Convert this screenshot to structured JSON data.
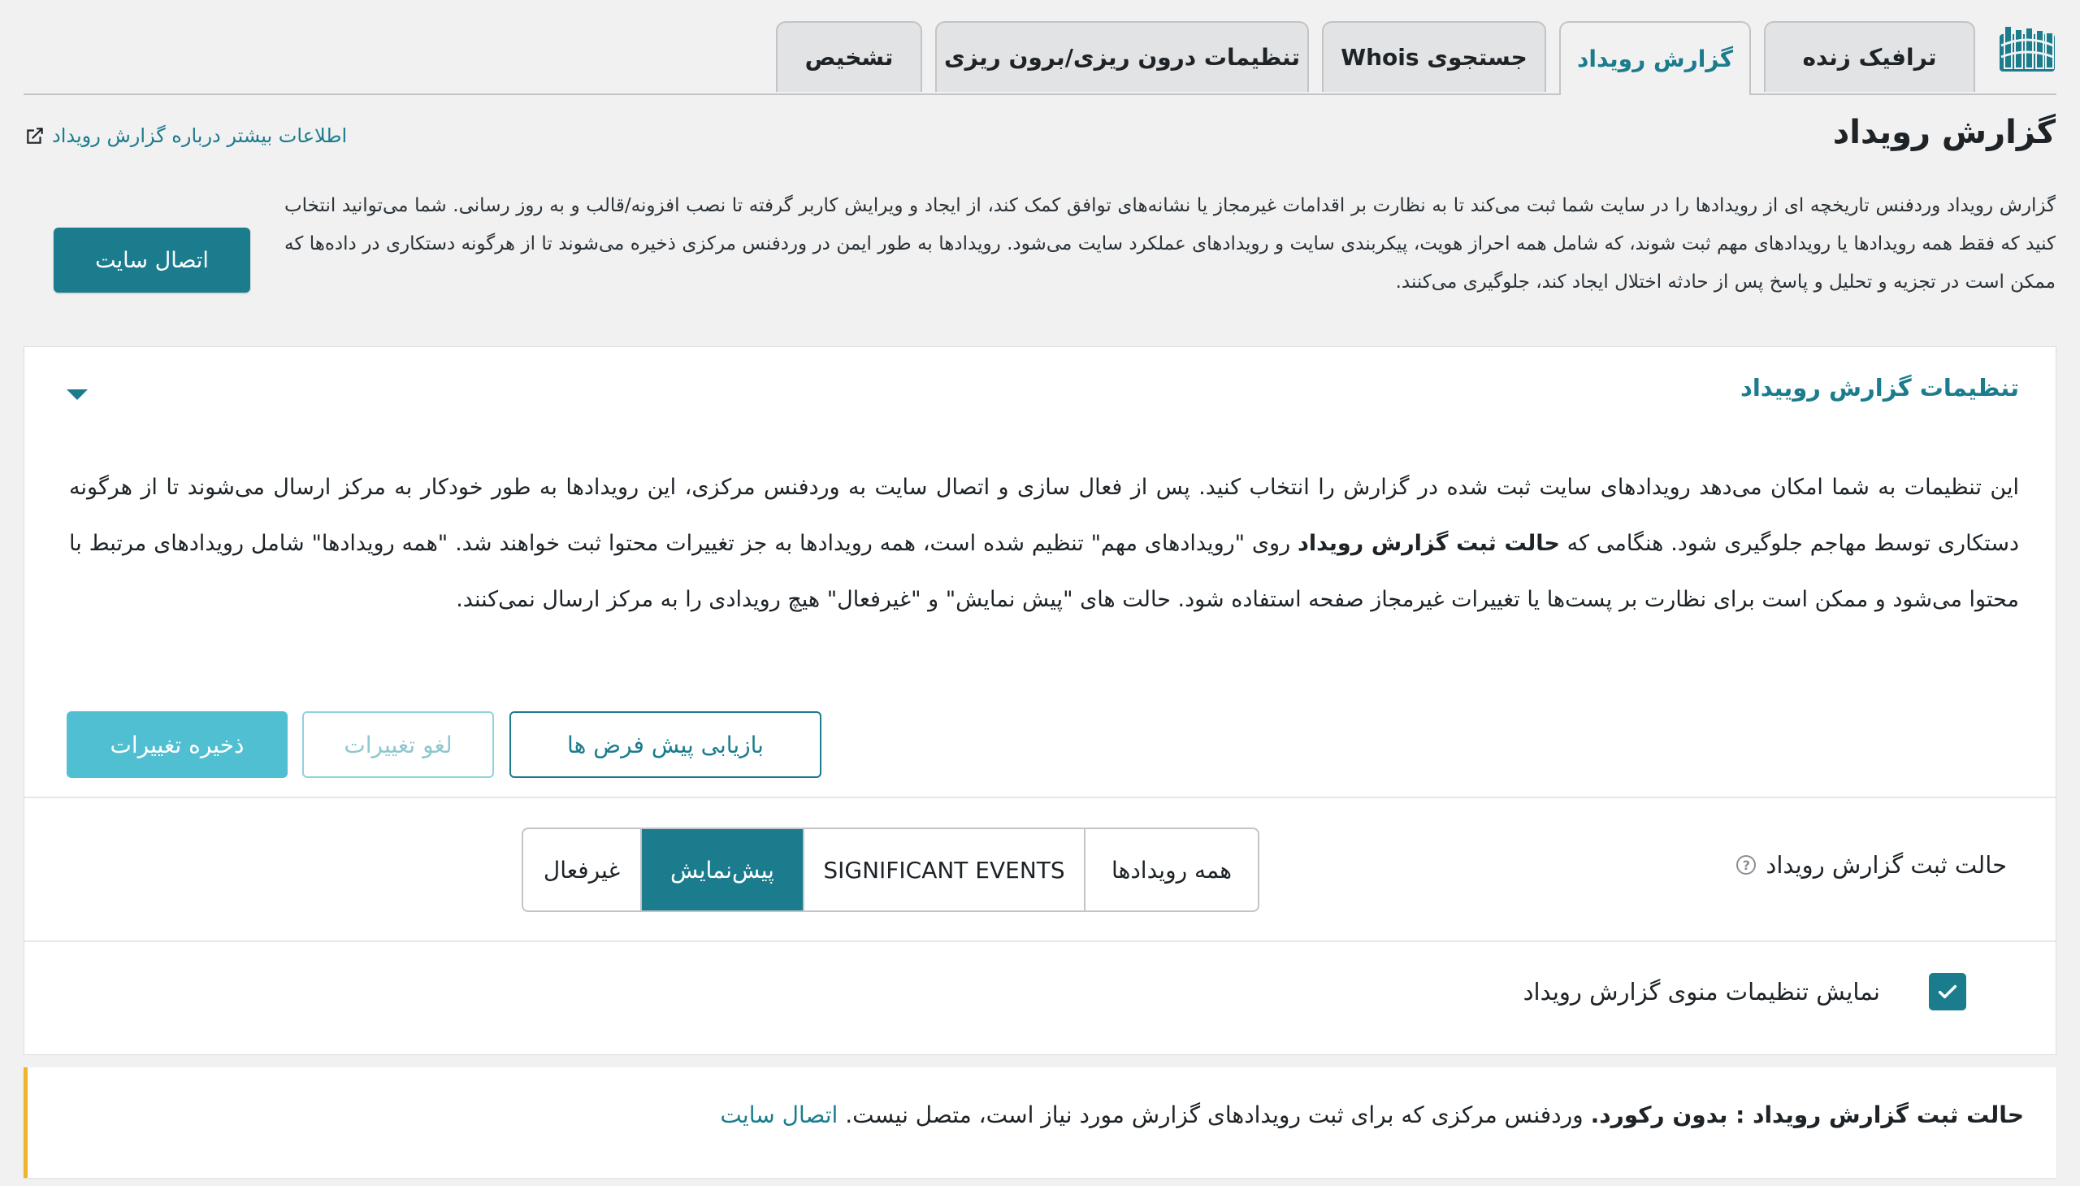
{
  "tabs": [
    {
      "label": "ترافیک زنده",
      "active": false
    },
    {
      "label": "گزارش رویداد",
      "active": true
    },
    {
      "label": "جستجوی Whois",
      "active": false
    },
    {
      "label": "تنظیمات درون ریزی/برون ریزی",
      "active": false
    },
    {
      "label": "تشخیص",
      "active": false
    }
  ],
  "page": {
    "title": "گزارش رویداد",
    "learn_more": "اطلاعات بیشتر درباره گزارش رویداد",
    "description": "گزارش رویداد وردفنس تاریخچه ای از رویدادها را در سایت شما ثبت می‌کند تا به نظارت بر اقدامات غیرمجاز یا نشانه‌های توافق کمک کند، از ایجاد و ویرایش کاربر گرفته تا نصب افزونه/قالب و به روز رسانی. شما می‌توانید انتخاب کنید که فقط همه رویدادها یا رویدادهای مهم ثبت شوند، که شامل همه احراز هویت، پیکربندی سایت و رویدادهای عملکرد سایت می‌شود. رویدادها به طور ایمن در وردفنس مرکزی ذخیره می‌شوند تا از هرگونه دستکاری در داده‌ها که ممکن است در تجزیه و تحلیل و پاسخ پس از حادثه اختلال ایجاد کند، جلوگیری می‌کنند.",
    "connect_button": "اتصال سایت"
  },
  "settings": {
    "title": "تنظیمات گزارش روییداد",
    "body_1": "این تنظیمات به شما امکان می‌دهد رویدادهای سایت ثبت شده در گزارش را انتخاب کنید. پس از فعال سازی و اتصال سایت به وردفنس مرکزی، این رویدادها به طور خودکار به مرکز ارسال می‌شوند تا از هرگونه دستکاری توسط مهاجم جلوگیری شود. هنگامی که ",
    "body_bold": "حالت ثبت گزارش رویداد",
    "body_2": " روی \"رویدادهای مهم\" تنظیم شده است، همه رویدادها به جز تغییرات محتوا ثبت خواهند شد. \"همه رویدادها\" شامل رویدادهای مرتبط با محتوا می‌شود و ممکن است برای نظارت بر پست‌ها یا تغییرات غیرمجاز صفحه استفاده شود. حالت های \"پیش نمایش\" و \"غیرفعال\" هیچ رویدادی را به مرکز ارسال نمی‌کنند.",
    "reset_button": "بازیابی پیش فرض ها",
    "cancel_button": "لغو تغییرات",
    "save_button": "ذخیره تغییرات",
    "mode_label": "حالت ثبت گزارش رویداد",
    "modes": [
      {
        "label": "همه رویدادها",
        "active": false
      },
      {
        "label": "SIGNIFICANT EVENTS",
        "active": false
      },
      {
        "label": "پیش‌نمایش",
        "active": true
      },
      {
        "label": "غیرفعال",
        "active": false
      }
    ],
    "menu_checkbox_label": "نمایش تنظیمات منوی گزارش رویداد",
    "menu_checkbox_checked": true
  },
  "notice": {
    "bold": "حالت ثبت گزارش رویداد : بدون رکورد.",
    "text": " وردفنس مرکزی که برای ثبت رویدادهای گزارش مورد نیاز است، متصل نیست. ",
    "link": "اتصال سایت"
  },
  "colors": {
    "accent": "#1b7c8d",
    "save_button": "#4fbfd1",
    "notice_border": "#f0b429"
  }
}
